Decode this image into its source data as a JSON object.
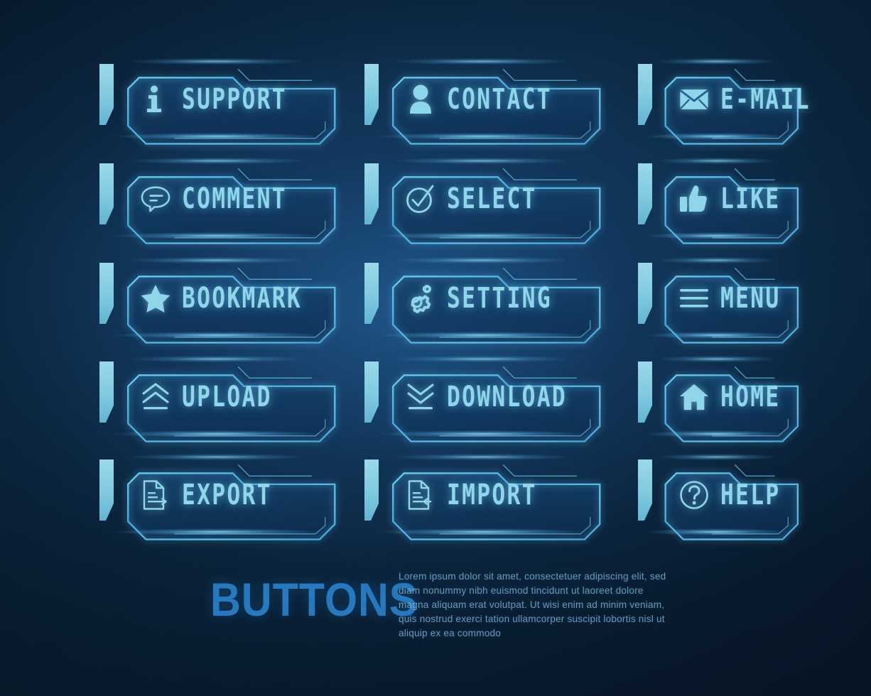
{
  "theme": {
    "background_deep": "#08182b",
    "background_mid": "#0c2a45",
    "glow_cyan": "#8fd6ea",
    "accent_bar": "#9ad9ea",
    "frame_stroke": "#4fb9e8",
    "title_blue": "#2878bd",
    "body_text": "#7fb3d6"
  },
  "buttons": [
    {
      "id": "support",
      "label": "SUPPORT",
      "icon": "info-icon",
      "column": 1,
      "row": 1
    },
    {
      "id": "contact",
      "label": "CONTACT",
      "icon": "person-icon",
      "column": 2,
      "row": 1
    },
    {
      "id": "email",
      "label": "E-MAIL",
      "icon": "envelope-icon",
      "column": 3,
      "row": 1
    },
    {
      "id": "comment",
      "label": "COMMENT",
      "icon": "speech-bubble-icon",
      "column": 1,
      "row": 2
    },
    {
      "id": "select",
      "label": "SELECT",
      "icon": "check-circle-icon",
      "column": 2,
      "row": 2
    },
    {
      "id": "like",
      "label": "LIKE",
      "icon": "thumbs-up-icon",
      "column": 3,
      "row": 2
    },
    {
      "id": "bookmark",
      "label": "BOOKMARK",
      "icon": "star-icon",
      "column": 1,
      "row": 3
    },
    {
      "id": "setting",
      "label": "SETTING",
      "icon": "gears-icon",
      "column": 2,
      "row": 3
    },
    {
      "id": "menu",
      "label": "MENU",
      "icon": "hamburger-menu-icon",
      "column": 3,
      "row": 3
    },
    {
      "id": "upload",
      "label": "UPLOAD",
      "icon": "chevron-up-double-icon",
      "column": 1,
      "row": 4
    },
    {
      "id": "download",
      "label": "DOWNLOAD",
      "icon": "chevron-down-double-icon",
      "column": 2,
      "row": 4
    },
    {
      "id": "home",
      "label": "HOME",
      "icon": "house-icon",
      "column": 3,
      "row": 4
    },
    {
      "id": "export",
      "label": "EXPORT",
      "icon": "document-arrow-out-icon",
      "column": 1,
      "row": 5
    },
    {
      "id": "import",
      "label": "IMPORT",
      "icon": "document-arrow-in-icon",
      "column": 2,
      "row": 5
    },
    {
      "id": "help",
      "label": "HELP",
      "icon": "question-circle-icon",
      "column": 3,
      "row": 5
    }
  ],
  "footer": {
    "title": "BUTTONS",
    "blurb": "Lorem ipsum dolor sit amet, consectetuer adipiscing elit, sed diam nonummy nibh euismod tincidunt ut laoreet dolore magna aliquam erat volutpat. Ut wisi enim ad minim veniam, quis nostrud exerci tation ullamcorper suscipit lobortis nisl ut aliquip ex ea commodo"
  }
}
